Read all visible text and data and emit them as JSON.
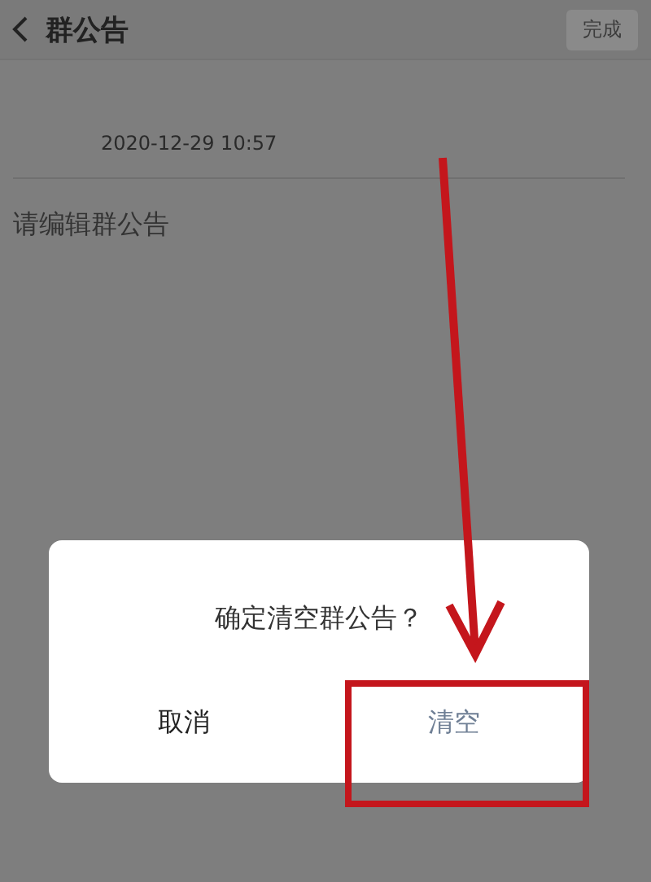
{
  "header": {
    "title": "群公告",
    "action": "完成"
  },
  "notice": {
    "time": "2020-12-29 10:57",
    "placeholder": "请编辑群公告"
  },
  "dialog": {
    "message": "确定清空群公告？",
    "buttons": [
      {
        "label": "取消",
        "kind": "cancel"
      },
      {
        "label": "清空",
        "kind": "confirm"
      }
    ]
  }
}
